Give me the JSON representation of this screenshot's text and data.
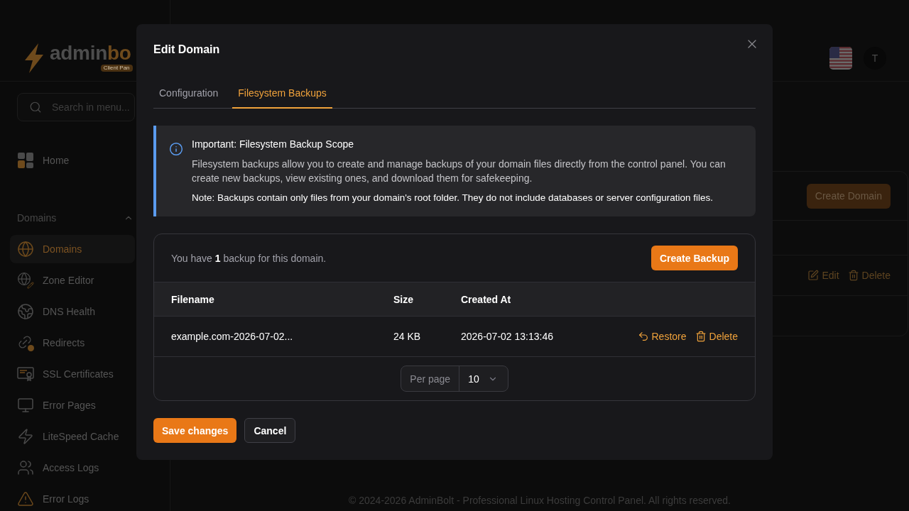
{
  "sidebar": {
    "logo": {
      "name": "admin",
      "accent": "bo",
      "badge": "Client Pan"
    },
    "search": {
      "placeholder": "Search in menu..."
    },
    "items": [
      {
        "label": "Home",
        "selected": false
      }
    ],
    "groups": [
      {
        "title": "Domains",
        "expanded": true,
        "items": [
          {
            "label": "Domains",
            "selected": true
          },
          {
            "label": "Zone Editor",
            "selected": false
          },
          {
            "label": "DNS Health",
            "selected": false
          },
          {
            "label": "Redirects",
            "selected": false
          },
          {
            "label": "SSL Certificates",
            "selected": false
          },
          {
            "label": "Error Pages",
            "selected": false
          },
          {
            "label": "LiteSpeed Cache",
            "selected": false
          },
          {
            "label": "Access Logs",
            "selected": false
          },
          {
            "label": "Error Logs",
            "selected": false
          }
        ]
      }
    ]
  },
  "header": {
    "avatar": "T"
  },
  "main": {
    "create_button": "Create Domain",
    "row_actions": [
      {
        "label": "Edit",
        "kind": "edit"
      },
      {
        "label": "Delete",
        "kind": "delete"
      }
    ]
  },
  "footer": "© 2024-2026 AdminBolt - Professional Linux Hosting Control Panel. All rights reserved.",
  "modal": {
    "title": "Edit Domain",
    "tabs": [
      {
        "label": "Configuration",
        "selected": false
      },
      {
        "label": "Filesystem Backups",
        "selected": true
      }
    ],
    "notice": {
      "title": "Important: Filesystem Backup Scope",
      "body": "Filesystem backups allow you to create and manage backups of your domain files directly from the control panel. You can create new backups, view existing ones, and download them for safekeeping.",
      "note": "Note: Backups contain only files from your domain's root folder. They do not include databases or server configuration files."
    },
    "backups": {
      "summary": "You have **1** backup for this domain.",
      "create_button": "Create Backup",
      "columns": [
        "Filename",
        "Size",
        "Created At"
      ],
      "rows": [
        {
          "filename": "example.com-2026-07-02...",
          "size": "24 KB",
          "created_at": "2026-07-02 13:13:46",
          "actions": [
            {
              "label": "Restore",
              "kind": "restore"
            },
            {
              "label": "Delete",
              "kind": "delete"
            }
          ]
        }
      ],
      "per_page": {
        "label": "Per page",
        "value": "10"
      }
    },
    "buttons": [
      {
        "label": "Save changes",
        "kind": "primary"
      },
      {
        "label": "Cancel",
        "kind": "secondary"
      }
    ]
  }
}
